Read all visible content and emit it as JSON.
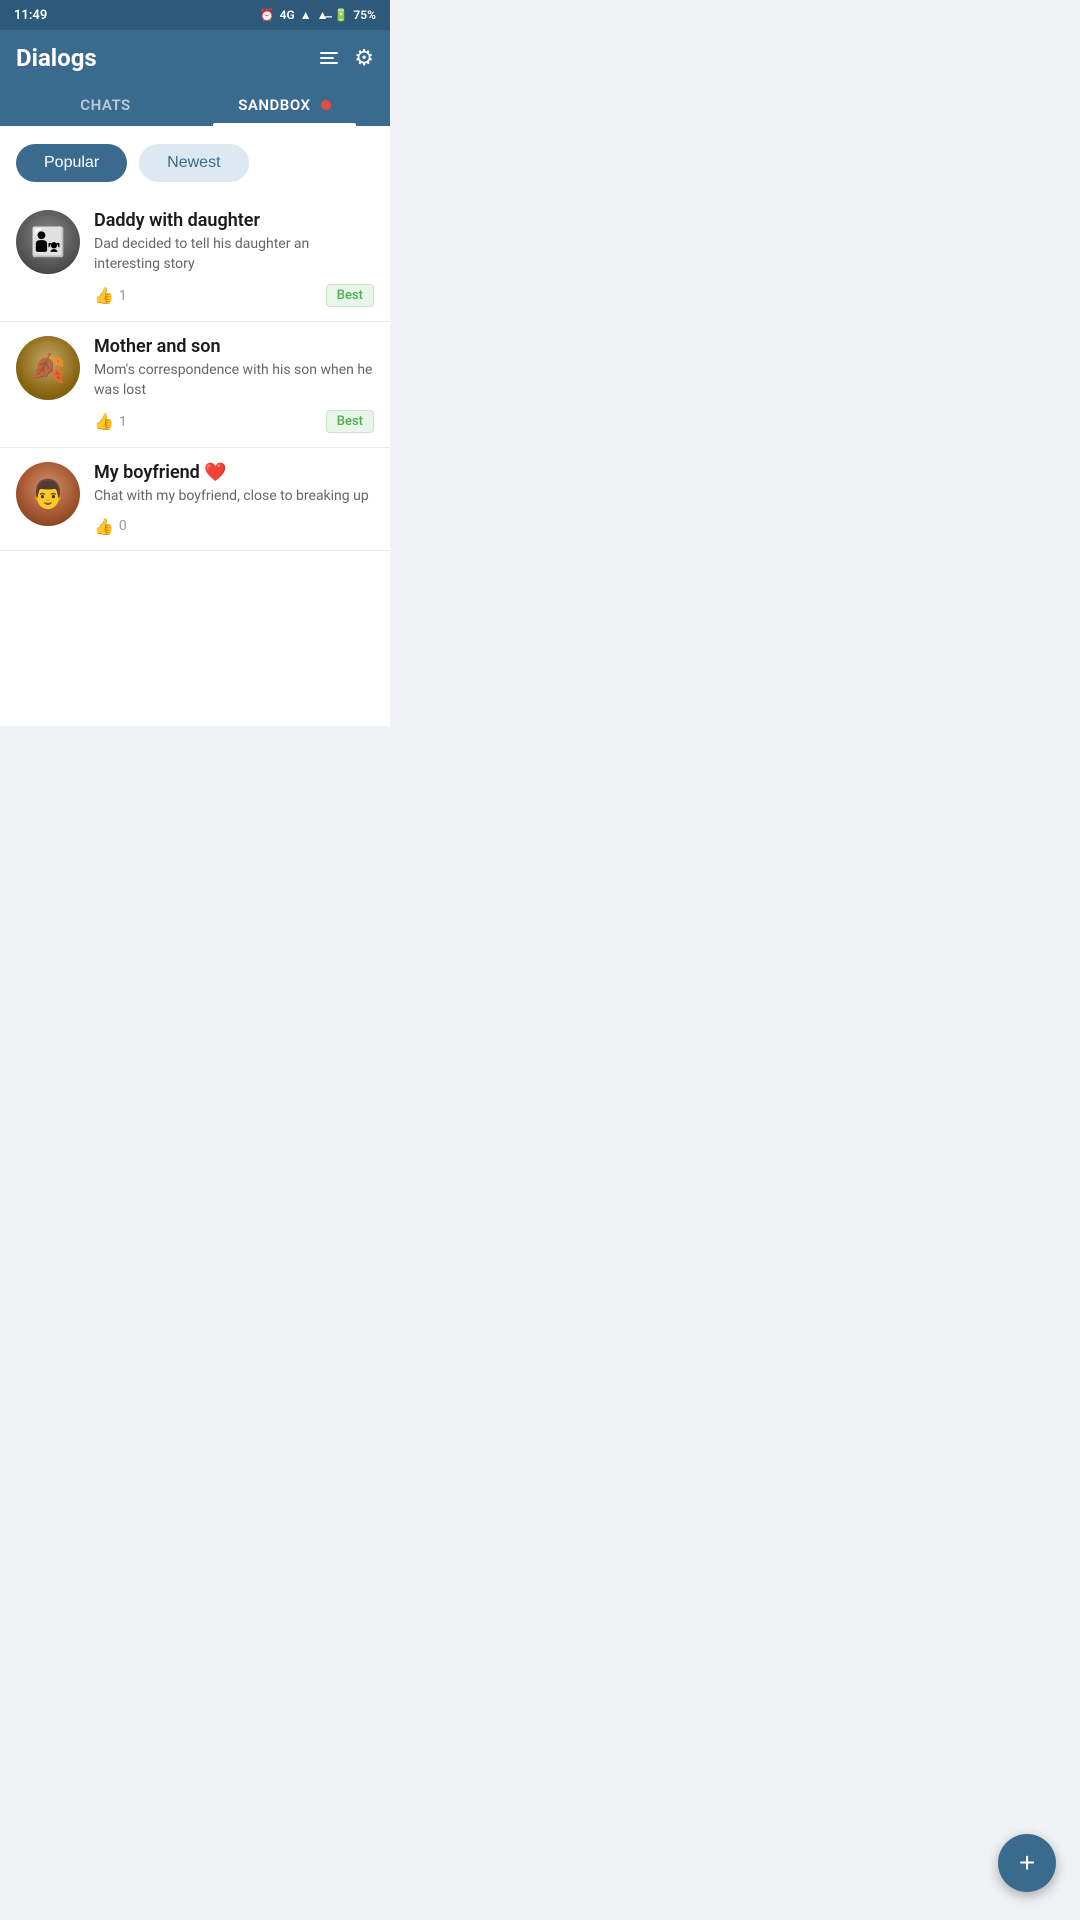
{
  "statusBar": {
    "time": "11:49",
    "network": "4G",
    "battery": "75%"
  },
  "header": {
    "title": "Dialogs",
    "addListIcon": "add-list-icon",
    "settingsIcon": "settings-icon"
  },
  "tabs": [
    {
      "id": "chats",
      "label": "CHATS",
      "active": false
    },
    {
      "id": "sandbox",
      "label": "SANDBOX",
      "active": true,
      "hasDot": true
    }
  ],
  "filters": [
    {
      "id": "popular",
      "label": "Popular",
      "active": true
    },
    {
      "id": "newest",
      "label": "Newest",
      "active": false
    }
  ],
  "chats": [
    {
      "id": "daddy-daughter",
      "title": "Daddy with daughter",
      "description": "Dad decided to tell his daughter an interesting story",
      "likes": 1,
      "badge": "Best",
      "avatarType": "daddy"
    },
    {
      "id": "mother-son",
      "title": "Mother and son",
      "description": "Mom's correspondence with his son when he was lost",
      "likes": 1,
      "badge": "Best",
      "avatarType": "mother"
    },
    {
      "id": "my-boyfriend",
      "title": "My boyfriend",
      "titleSuffix": "❤️",
      "description": "Chat with my boyfriend, close to breaking up",
      "likes": 0,
      "badge": null,
      "avatarType": "boyfriend"
    }
  ],
  "fab": {
    "label": "+"
  }
}
